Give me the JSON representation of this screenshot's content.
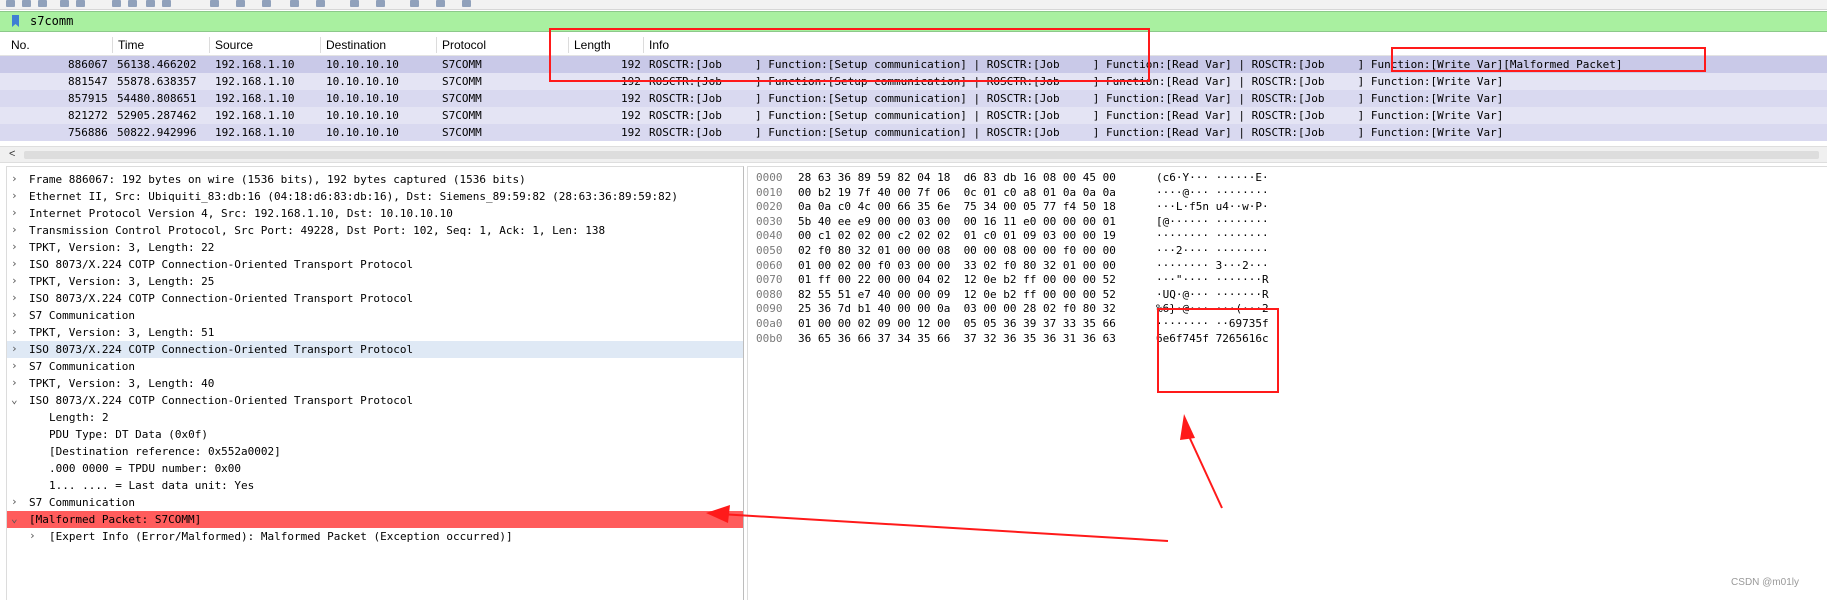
{
  "filter": {
    "value": "s7comm"
  },
  "packet_list": {
    "columns": [
      "No.",
      "Time",
      "Source",
      "Destination",
      "Protocol",
      "Length",
      "Info"
    ],
    "rows": [
      {
        "no": "886067",
        "time": "56138.466202",
        "src": "192.168.1.10",
        "dst": "10.10.10.10",
        "proto": "S7COMM",
        "len": "192",
        "info": "ROSCTR:[Job     ] Function:[Setup communication] | ROSCTR:[Job     ] Function:[Read Var] | ROSCTR:[Job     ] Function:[Write Var][Malformed Packet]"
      },
      {
        "no": "881547",
        "time": "55878.638357",
        "src": "192.168.1.10",
        "dst": "10.10.10.10",
        "proto": "S7COMM",
        "len": "192",
        "info": "ROSCTR:[Job     ] Function:[Setup communication] | ROSCTR:[Job     ] Function:[Read Var] | ROSCTR:[Job     ] Function:[Write Var]"
      },
      {
        "no": "857915",
        "time": "54480.808651",
        "src": "192.168.1.10",
        "dst": "10.10.10.10",
        "proto": "S7COMM",
        "len": "192",
        "info": "ROSCTR:[Job     ] Function:[Setup communication] | ROSCTR:[Job     ] Function:[Read Var] | ROSCTR:[Job     ] Function:[Write Var]"
      },
      {
        "no": "821272",
        "time": "52905.287462",
        "src": "192.168.1.10",
        "dst": "10.10.10.10",
        "proto": "S7COMM",
        "len": "192",
        "info": "ROSCTR:[Job     ] Function:[Setup communication] | ROSCTR:[Job     ] Function:[Read Var] | ROSCTR:[Job     ] Function:[Write Var]"
      },
      {
        "no": "756886",
        "time": "50822.942996",
        "src": "192.168.1.10",
        "dst": "10.10.10.10",
        "proto": "S7COMM",
        "len": "192",
        "info": "ROSCTR:[Job     ] Function:[Setup communication] | ROSCTR:[Job     ] Function:[Read Var] | ROSCTR:[Job     ] Function:[Write Var]"
      }
    ]
  },
  "detail_tree": [
    {
      "text": "Frame 886067: 192 bytes on wire (1536 bits), 192 bytes captured (1536 bits)",
      "arrow": "›",
      "indent": 0,
      "state": ""
    },
    {
      "text": "Ethernet II, Src: Ubiquiti_83:db:16 (04:18:d6:83:db:16), Dst: Siemens_89:59:82 (28:63:36:89:59:82)",
      "arrow": "›",
      "indent": 0,
      "state": ""
    },
    {
      "text": "Internet Protocol Version 4, Src: 192.168.1.10, Dst: 10.10.10.10",
      "arrow": "›",
      "indent": 0,
      "state": ""
    },
    {
      "text": "Transmission Control Protocol, Src Port: 49228, Dst Port: 102, Seq: 1, Ack: 1, Len: 138",
      "arrow": "›",
      "indent": 0,
      "state": ""
    },
    {
      "text": "TPKT, Version: 3, Length: 22",
      "arrow": "›",
      "indent": 0,
      "state": ""
    },
    {
      "text": "ISO 8073/X.224 COTP Connection-Oriented Transport Protocol",
      "arrow": "›",
      "indent": 0,
      "state": ""
    },
    {
      "text": "TPKT, Version: 3, Length: 25",
      "arrow": "›",
      "indent": 0,
      "state": ""
    },
    {
      "text": "ISO 8073/X.224 COTP Connection-Oriented Transport Protocol",
      "arrow": "›",
      "indent": 0,
      "state": ""
    },
    {
      "text": "S7 Communication",
      "arrow": "›",
      "indent": 0,
      "state": ""
    },
    {
      "text": "TPKT, Version: 3, Length: 51",
      "arrow": "›",
      "indent": 0,
      "state": ""
    },
    {
      "text": "ISO 8073/X.224 COTP Connection-Oriented Transport Protocol",
      "arrow": "›",
      "indent": 0,
      "state": "hl"
    },
    {
      "text": "S7 Communication",
      "arrow": "›",
      "indent": 0,
      "state": ""
    },
    {
      "text": "TPKT, Version: 3, Length: 40",
      "arrow": "›",
      "indent": 0,
      "state": ""
    },
    {
      "text": "ISO 8073/X.224 COTP Connection-Oriented Transport Protocol",
      "arrow": "⌄",
      "indent": 0,
      "state": ""
    },
    {
      "text": "Length: 2",
      "arrow": "",
      "indent": 1,
      "state": ""
    },
    {
      "text": "PDU Type: DT Data (0x0f)",
      "arrow": "",
      "indent": 1,
      "state": ""
    },
    {
      "text": "[Destination reference: 0x552a0002]",
      "arrow": "",
      "indent": 1,
      "state": ""
    },
    {
      "text": ".000 0000 = TPDU number: 0x00",
      "arrow": "",
      "indent": 1,
      "state": ""
    },
    {
      "text": "1... .... = Last data unit: Yes",
      "arrow": "",
      "indent": 1,
      "state": ""
    },
    {
      "text": "S7 Communication",
      "arrow": "›",
      "indent": 0,
      "state": ""
    },
    {
      "text": "[Malformed Packet: S7COMM]",
      "arrow": "⌄",
      "indent": 0,
      "state": "err"
    },
    {
      "text": "[Expert Info (Error/Malformed): Malformed Packet (Exception occurred)]",
      "arrow": "›",
      "indent": 1,
      "state": ""
    }
  ],
  "bytes": [
    {
      "offset": "0000",
      "hex": "28 63 36 89 59 82 04 18  d6 83 db 16 08 00 45 00",
      "ascii": "(c6·Y··· ······E·"
    },
    {
      "offset": "0010",
      "hex": "00 b2 19 7f 40 00 7f 06  0c 01 c0 a8 01 0a 0a 0a",
      "ascii": "····@··· ········"
    },
    {
      "offset": "0020",
      "hex": "0a 0a c0 4c 00 66 35 6e  75 34 00 05 77 f4 50 18",
      "ascii": "···L·f5n u4··w·P·"
    },
    {
      "offset": "0030",
      "hex": "5b 40 ee e9 00 00 03 00  00 16 11 e0 00 00 00 01",
      "ascii": "[@······ ········"
    },
    {
      "offset": "0040",
      "hex": "00 c1 02 02 00 c2 02 02  01 c0 01 09 03 00 00 19",
      "ascii": "········ ········"
    },
    {
      "offset": "0050",
      "hex": "02 f0 80 32 01 00 00 08  00 00 08 00 00 f0 00 00",
      "ascii": "···2···· ········"
    },
    {
      "offset": "0060",
      "hex": "01 00 02 00 f0 03 00 00  33 02 f0 80 32 01 00 00",
      "ascii": "········ 3···2···"
    },
    {
      "offset": "0070",
      "hex": "01 ff 00 22 00 00 04 02  12 0e b2 ff 00 00 00 52",
      "ascii": "···\"···· ·······R"
    },
    {
      "offset": "0080",
      "hex": "82 55 51 e7 40 00 00 09  12 0e b2 ff 00 00 00 52",
      "ascii": "·UQ·@··· ·······R"
    },
    {
      "offset": "0090",
      "hex": "25 36 7d b1 40 00 00 0a  03 00 00 28 02 f0 80 32",
      "ascii": "%6}·@··· ···(···2"
    },
    {
      "offset": "00a0",
      "hex": "01 00 00 02 09 00 12 00  05 05 36 39 37 33 35 66",
      "ascii": "········ ··69735f"
    },
    {
      "offset": "00b0",
      "hex": "36 65 36 66 37 34 35 66  37 32 36 35 36 31 36 63",
      "ascii": "6e6f745f 7265616c"
    }
  ],
  "watermark": "CSDN @m01ly",
  "colors": {
    "filter_bg": "#a9f0a0",
    "row_bg": "#e4e4f4",
    "selected_row_bg": "#c9c9e8",
    "error_bg": "#ff5c5c",
    "annotation": "#ff1a1a"
  }
}
